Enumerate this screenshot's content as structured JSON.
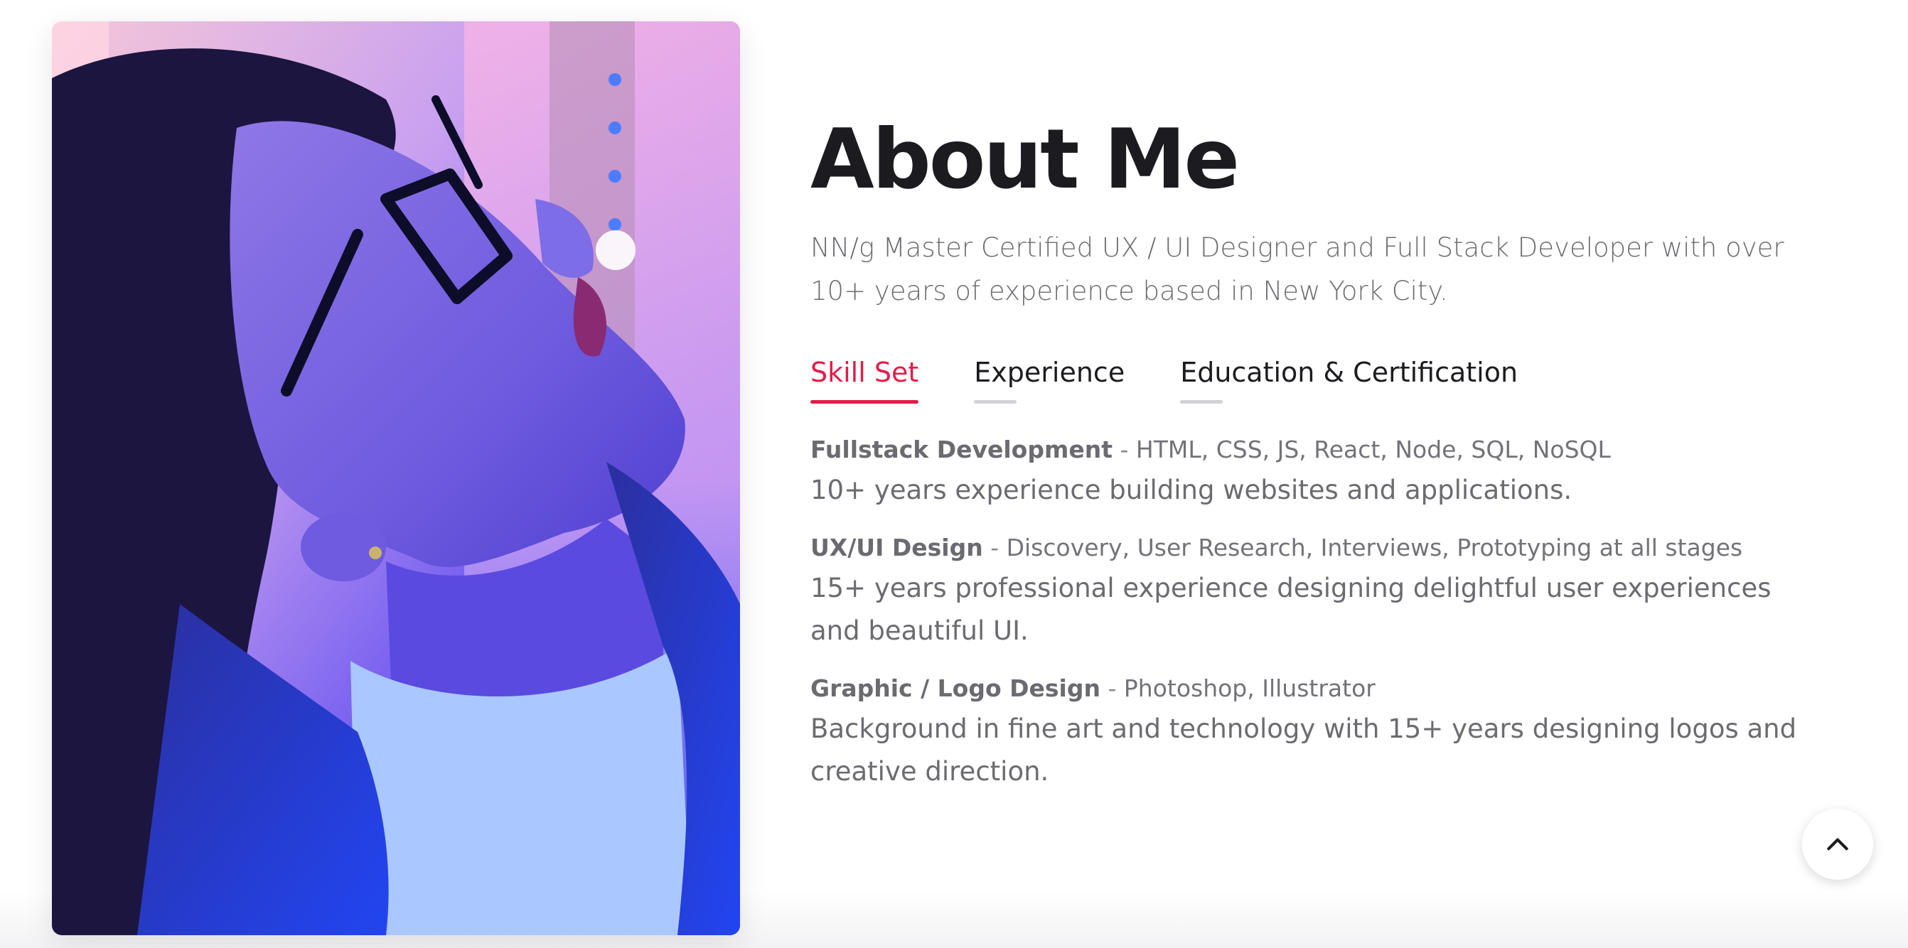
{
  "about": {
    "title": "About Me",
    "intro": "NN/g Master Certified UX / UI Designer and Full Stack Developer with over 10+ years of experience based in New York City."
  },
  "tabs": [
    {
      "label": "Skill Set",
      "active": true
    },
    {
      "label": "Experience",
      "active": false
    },
    {
      "label": "Education & Certification",
      "active": false
    }
  ],
  "skills": [
    {
      "name": "Fullstack Development",
      "separator": " - ",
      "tools": "HTML, CSS, JS, React, Node, SQL, NoSQL",
      "description": "10+ years experience building websites and applications."
    },
    {
      "name": "UX/UI Design",
      "separator": " - ",
      "tools": "Discovery, User Research, Interviews, Prototyping at all stages",
      "description": "15+ years professional experience designing delightful user experiences and beautiful UI."
    },
    {
      "name": "Graphic / Logo Design",
      "separator": " - ",
      "tools": "Photoshop, Illustrator",
      "description": "Background in fine art and technology with 15+ years designing logos and creative direction."
    }
  ],
  "icons": {
    "back_to_top": "chevron-up-icon"
  },
  "colors": {
    "accent": "#e11d48",
    "heading": "#1c1c20",
    "body_text": "#6b6b70",
    "photo_primary": "#3a2bd8"
  }
}
